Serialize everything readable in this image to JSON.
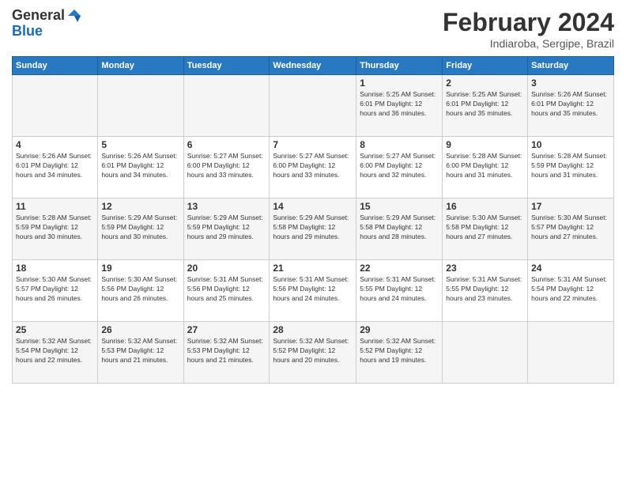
{
  "header": {
    "logo_line1": "General",
    "logo_line2": "Blue",
    "title": "February 2024",
    "location": "Indiaroba, Sergipe, Brazil"
  },
  "days_of_week": [
    "Sunday",
    "Monday",
    "Tuesday",
    "Wednesday",
    "Thursday",
    "Friday",
    "Saturday"
  ],
  "weeks": [
    [
      {
        "day": "",
        "info": ""
      },
      {
        "day": "",
        "info": ""
      },
      {
        "day": "",
        "info": ""
      },
      {
        "day": "",
        "info": ""
      },
      {
        "day": "1",
        "info": "Sunrise: 5:25 AM\nSunset: 6:01 PM\nDaylight: 12 hours\nand 36 minutes."
      },
      {
        "day": "2",
        "info": "Sunrise: 5:25 AM\nSunset: 6:01 PM\nDaylight: 12 hours\nand 35 minutes."
      },
      {
        "day": "3",
        "info": "Sunrise: 5:26 AM\nSunset: 6:01 PM\nDaylight: 12 hours\nand 35 minutes."
      }
    ],
    [
      {
        "day": "4",
        "info": "Sunrise: 5:26 AM\nSunset: 6:01 PM\nDaylight: 12 hours\nand 34 minutes."
      },
      {
        "day": "5",
        "info": "Sunrise: 5:26 AM\nSunset: 6:01 PM\nDaylight: 12 hours\nand 34 minutes."
      },
      {
        "day": "6",
        "info": "Sunrise: 5:27 AM\nSunset: 6:00 PM\nDaylight: 12 hours\nand 33 minutes."
      },
      {
        "day": "7",
        "info": "Sunrise: 5:27 AM\nSunset: 6:00 PM\nDaylight: 12 hours\nand 33 minutes."
      },
      {
        "day": "8",
        "info": "Sunrise: 5:27 AM\nSunset: 6:00 PM\nDaylight: 12 hours\nand 32 minutes."
      },
      {
        "day": "9",
        "info": "Sunrise: 5:28 AM\nSunset: 6:00 PM\nDaylight: 12 hours\nand 31 minutes."
      },
      {
        "day": "10",
        "info": "Sunrise: 5:28 AM\nSunset: 5:59 PM\nDaylight: 12 hours\nand 31 minutes."
      }
    ],
    [
      {
        "day": "11",
        "info": "Sunrise: 5:28 AM\nSunset: 5:59 PM\nDaylight: 12 hours\nand 30 minutes."
      },
      {
        "day": "12",
        "info": "Sunrise: 5:29 AM\nSunset: 5:59 PM\nDaylight: 12 hours\nand 30 minutes."
      },
      {
        "day": "13",
        "info": "Sunrise: 5:29 AM\nSunset: 5:59 PM\nDaylight: 12 hours\nand 29 minutes."
      },
      {
        "day": "14",
        "info": "Sunrise: 5:29 AM\nSunset: 5:58 PM\nDaylight: 12 hours\nand 29 minutes."
      },
      {
        "day": "15",
        "info": "Sunrise: 5:29 AM\nSunset: 5:58 PM\nDaylight: 12 hours\nand 28 minutes."
      },
      {
        "day": "16",
        "info": "Sunrise: 5:30 AM\nSunset: 5:58 PM\nDaylight: 12 hours\nand 27 minutes."
      },
      {
        "day": "17",
        "info": "Sunrise: 5:30 AM\nSunset: 5:57 PM\nDaylight: 12 hours\nand 27 minutes."
      }
    ],
    [
      {
        "day": "18",
        "info": "Sunrise: 5:30 AM\nSunset: 5:57 PM\nDaylight: 12 hours\nand 26 minutes."
      },
      {
        "day": "19",
        "info": "Sunrise: 5:30 AM\nSunset: 5:56 PM\nDaylight: 12 hours\nand 26 minutes."
      },
      {
        "day": "20",
        "info": "Sunrise: 5:31 AM\nSunset: 5:56 PM\nDaylight: 12 hours\nand 25 minutes."
      },
      {
        "day": "21",
        "info": "Sunrise: 5:31 AM\nSunset: 5:56 PM\nDaylight: 12 hours\nand 24 minutes."
      },
      {
        "day": "22",
        "info": "Sunrise: 5:31 AM\nSunset: 5:55 PM\nDaylight: 12 hours\nand 24 minutes."
      },
      {
        "day": "23",
        "info": "Sunrise: 5:31 AM\nSunset: 5:55 PM\nDaylight: 12 hours\nand 23 minutes."
      },
      {
        "day": "24",
        "info": "Sunrise: 5:31 AM\nSunset: 5:54 PM\nDaylight: 12 hours\nand 22 minutes."
      }
    ],
    [
      {
        "day": "25",
        "info": "Sunrise: 5:32 AM\nSunset: 5:54 PM\nDaylight: 12 hours\nand 22 minutes."
      },
      {
        "day": "26",
        "info": "Sunrise: 5:32 AM\nSunset: 5:53 PM\nDaylight: 12 hours\nand 21 minutes."
      },
      {
        "day": "27",
        "info": "Sunrise: 5:32 AM\nSunset: 5:53 PM\nDaylight: 12 hours\nand 21 minutes."
      },
      {
        "day": "28",
        "info": "Sunrise: 5:32 AM\nSunset: 5:52 PM\nDaylight: 12 hours\nand 20 minutes."
      },
      {
        "day": "29",
        "info": "Sunrise: 5:32 AM\nSunset: 5:52 PM\nDaylight: 12 hours\nand 19 minutes."
      },
      {
        "day": "",
        "info": ""
      },
      {
        "day": "",
        "info": ""
      }
    ]
  ]
}
